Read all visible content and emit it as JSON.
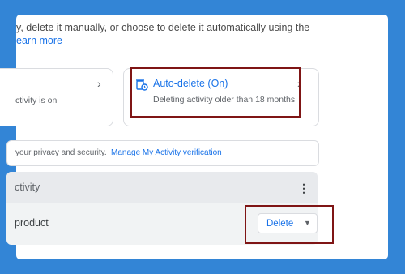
{
  "colors": {
    "background": "#3385d6",
    "link": "#1a73e8",
    "highlight": "#7f1515"
  },
  "intro": {
    "text": "y, delete it manually, or choose to delete it automatically using the",
    "link": "earn more"
  },
  "activity_card": {
    "desc": "ctivity is on",
    "chevron_icon": "chevron-right-icon"
  },
  "auto_delete": {
    "icon": "auto-delete-icon",
    "title": "Auto-delete (On)",
    "subtitle": "Deleting activity older than 18 months",
    "chevron_icon": "chevron-right-icon"
  },
  "privacy": {
    "text": "your privacy and security.",
    "link": "Manage My Activity verification"
  },
  "activity_section": {
    "title": "ctivity",
    "menu_icon": "more-vert-icon",
    "product_label": "product"
  },
  "delete_button": {
    "label": "Delete",
    "caret_icon": "caret-down-icon"
  }
}
